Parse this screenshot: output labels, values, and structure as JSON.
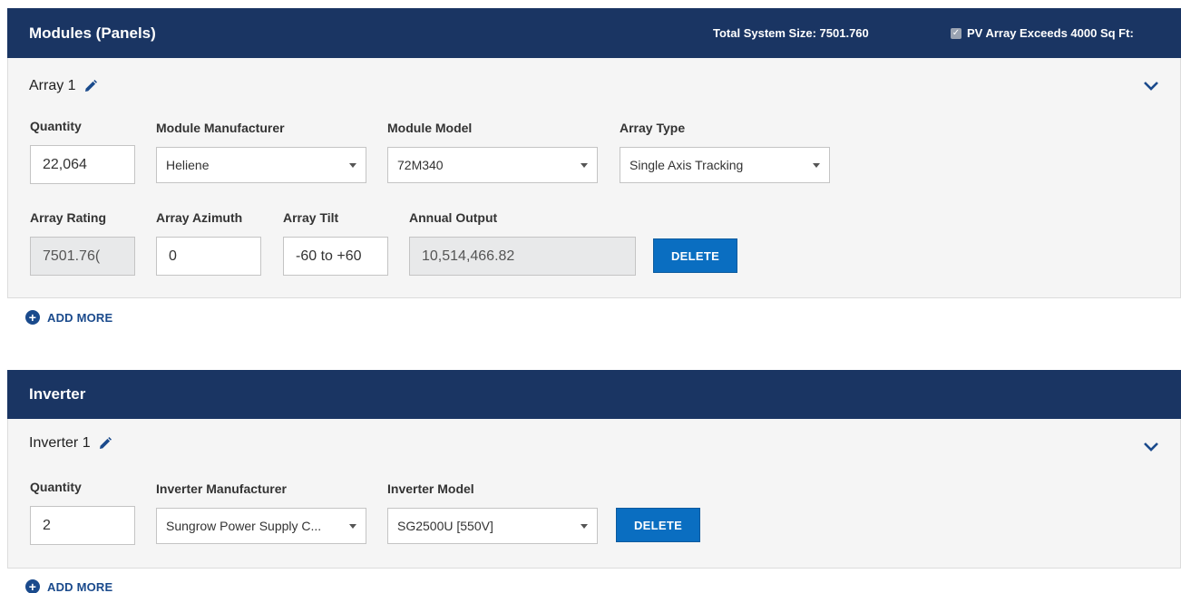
{
  "modules": {
    "title": "Modules (Panels)",
    "total_size_label": "Total System Size:",
    "total_size_value": "7501.760",
    "pv_exceeds_label": "PV Array Exceeds 4000 Sq Ft:",
    "pv_exceeds_checked": true,
    "array": {
      "title": "Array 1",
      "quantity_label": "Quantity",
      "quantity_value": "22,064",
      "manufacturer_label": "Module Manufacturer",
      "manufacturer_value": "Heliene",
      "model_label": "Module Model",
      "model_value": "72M340",
      "type_label": "Array Type",
      "type_value": "Single Axis Tracking",
      "rating_label": "Array Rating",
      "rating_value": "7501.76(",
      "azimuth_label": "Array Azimuth",
      "azimuth_value": "0",
      "tilt_label": "Array Tilt",
      "tilt_value": "-60 to +60",
      "output_label": "Annual Output",
      "output_value": "10,514,466.82",
      "delete_label": "DELETE"
    },
    "add_more_label": "ADD MORE"
  },
  "inverter": {
    "title": "Inverter",
    "item": {
      "title": "Inverter 1",
      "quantity_label": "Quantity",
      "quantity_value": "2",
      "manufacturer_label": "Inverter Manufacturer",
      "manufacturer_value": "Sungrow Power Supply C...",
      "model_label": "Inverter Model",
      "model_value": "SG2500U [550V]",
      "delete_label": "DELETE"
    },
    "add_more_label": "ADD MORE"
  },
  "colors": {
    "header_bg": "#1a3563",
    "accent": "#0a6ec1",
    "link": "#1a4a8c"
  },
  "icons": {
    "edit": "pencil-icon",
    "collapse": "chevron-down-icon",
    "add": "plus-circle-icon",
    "checkbox": "checkbox-icon"
  }
}
